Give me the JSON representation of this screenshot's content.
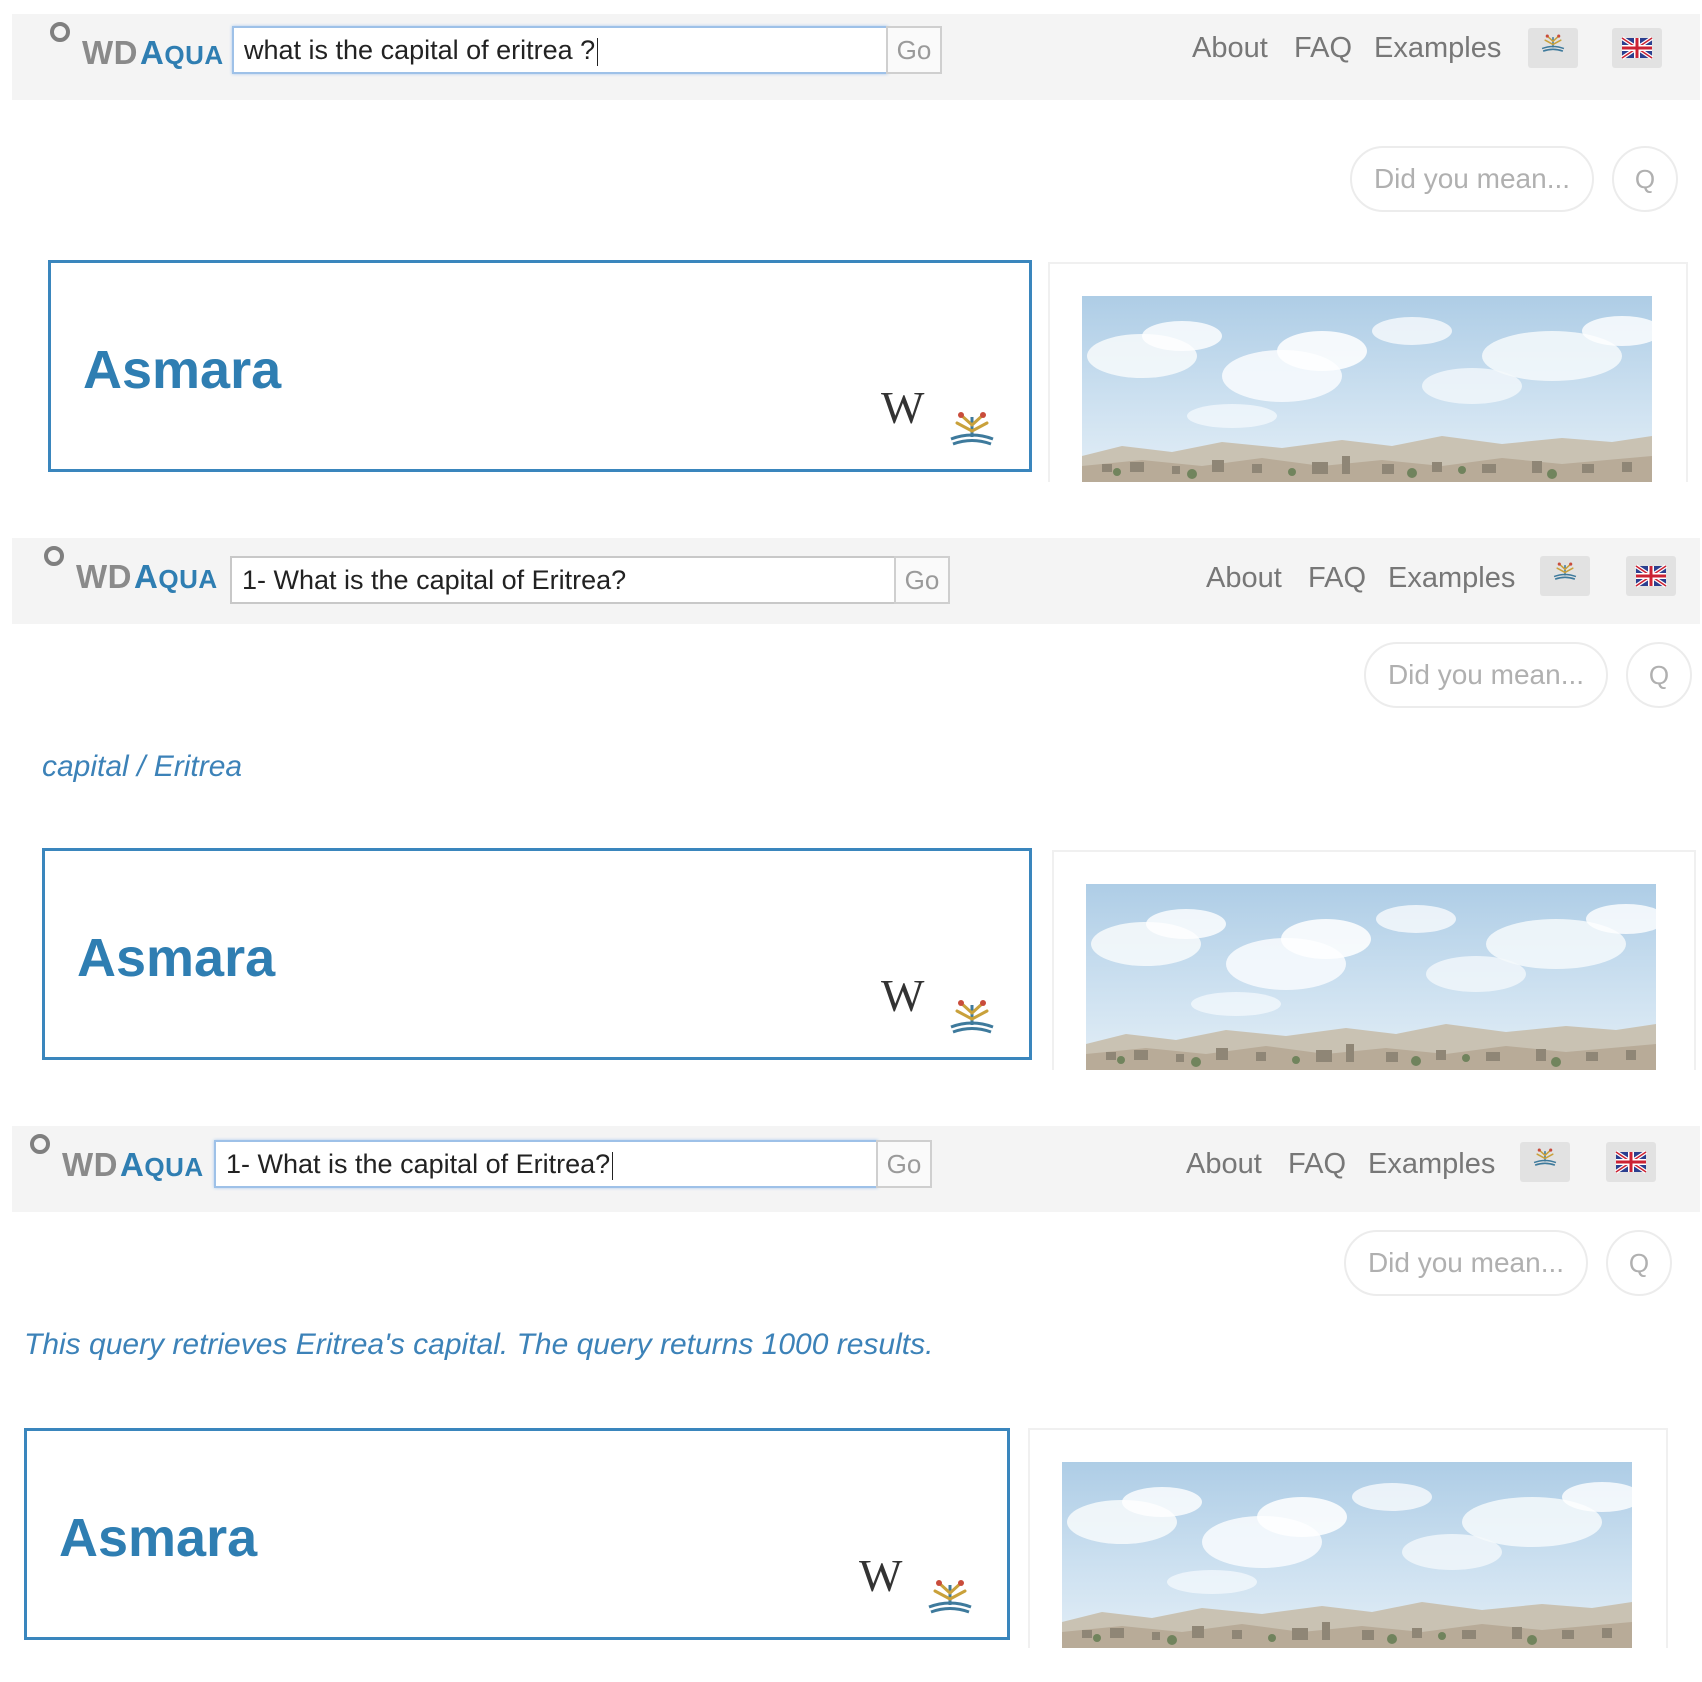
{
  "logo": {
    "wd": "WD",
    "aqua_first": "A",
    "aqua_rest": "QUA"
  },
  "nav": {
    "about": "About",
    "faq": "FAQ",
    "examples": "Examples",
    "go_label": "Go"
  },
  "did_you_mean": "Did you mean...",
  "q_button": "Q",
  "panels": [
    {
      "search_value": "what is the capital of eritrea ?",
      "interpretation": "",
      "answer": "Asmara"
    },
    {
      "search_value": "1- What is the capital of Eritrea?",
      "interpretation": "capital / Eritrea",
      "answer": "Asmara"
    },
    {
      "search_value": "1- What is the capital of Eritrea?",
      "interpretation": "This query retrieves Eritrea's capital. The query returns 1000 results.",
      "answer": "Asmara"
    }
  ],
  "icons": {
    "wikipedia": "wikipedia-icon",
    "wikidata": "wikidata-icon",
    "language_wikidata": "wikidata-language-icon",
    "language_english": "uk-flag-icon"
  },
  "colors": {
    "accent": "#2f7eb2",
    "navbar": "#f4f4f4",
    "border": "#3a86bd"
  }
}
